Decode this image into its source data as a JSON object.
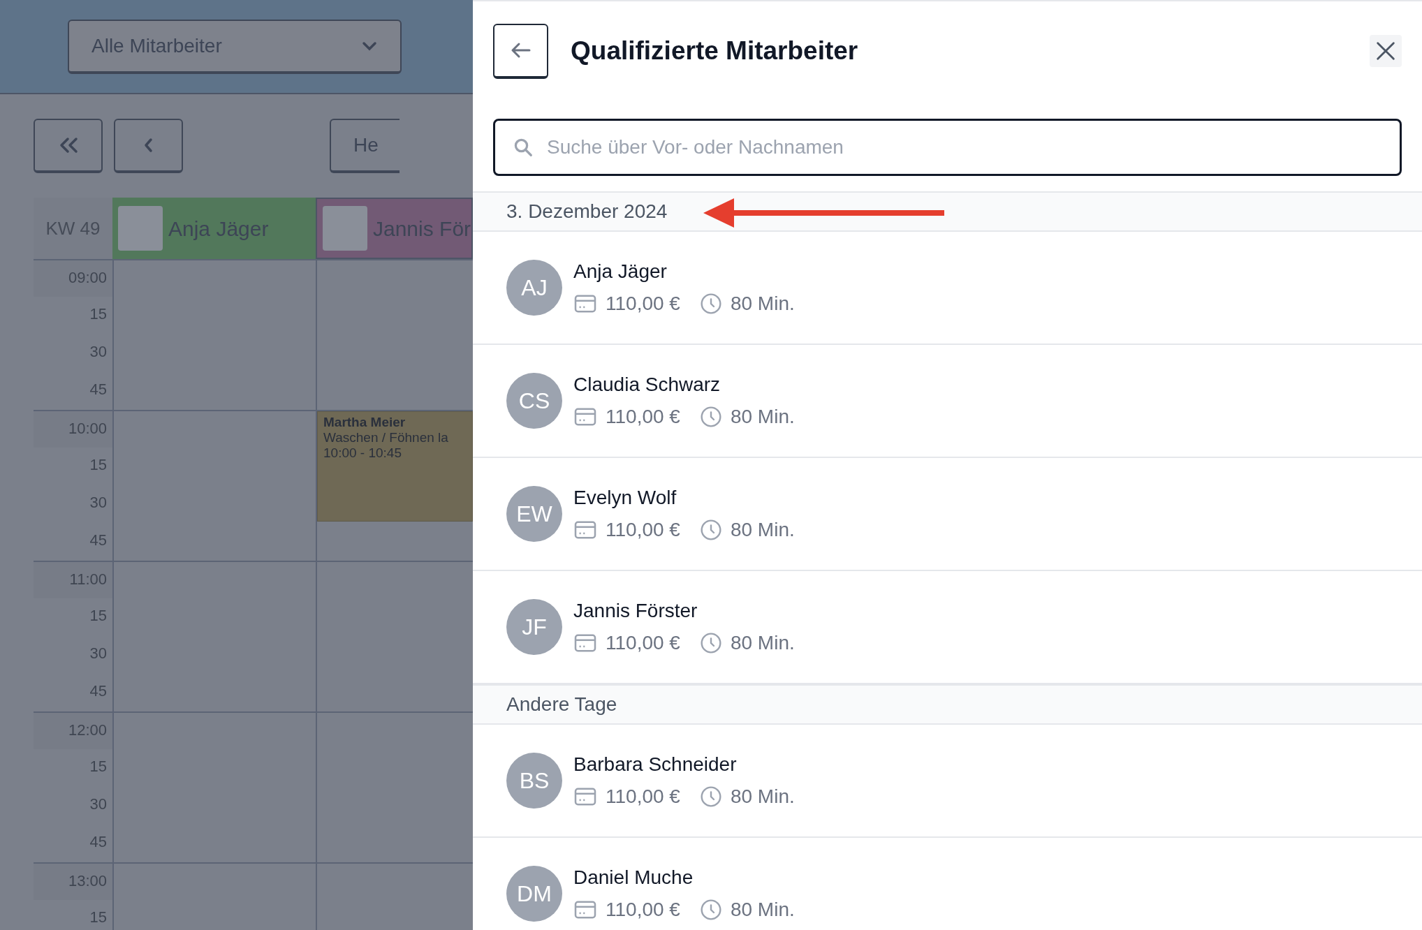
{
  "filter": {
    "value": "Alle Mitarbeiter"
  },
  "nav": {
    "today_label": "He"
  },
  "calendar": {
    "week": "KW 49",
    "columns": [
      {
        "name": "Anja Jäger",
        "color": "#52785b"
      },
      {
        "name": "Jannis För",
        "color": "#725a75",
        "events": [
          {
            "client": "Martha Meier",
            "service": "Waschen / Föhnen la",
            "time": "10:00 - 10:45",
            "color": "#6f6955"
          }
        ]
      }
    ],
    "rows": [
      {
        "time": "09:00",
        "kind": "hour"
      },
      {
        "time": "15",
        "kind": "quarter"
      },
      {
        "time": "30",
        "kind": "quarter"
      },
      {
        "time": "45",
        "kind": "quarter"
      },
      {
        "time": "10:00",
        "kind": "hour"
      },
      {
        "time": "15",
        "kind": "quarter"
      },
      {
        "time": "30",
        "kind": "quarter"
      },
      {
        "time": "45",
        "kind": "quarter"
      },
      {
        "time": "11:00",
        "kind": "hour"
      },
      {
        "time": "15",
        "kind": "quarter"
      },
      {
        "time": "30",
        "kind": "quarter"
      },
      {
        "time": "45",
        "kind": "quarter"
      },
      {
        "time": "12:00",
        "kind": "hour"
      },
      {
        "time": "15",
        "kind": "quarter"
      },
      {
        "time": "30",
        "kind": "quarter"
      },
      {
        "time": "45",
        "kind": "quarter"
      },
      {
        "time": "13:00",
        "kind": "hour"
      },
      {
        "time": "15",
        "kind": "quarter"
      }
    ]
  },
  "panel": {
    "title": "Qualifizierte Mitarbeiter",
    "search": {
      "placeholder": "Suche über Vor- oder Nachnamen"
    },
    "sections": [
      {
        "heading": "3. Dezember 2024",
        "annotated": true,
        "employees": [
          {
            "initials": "AJ",
            "name": "Anja Jäger",
            "price": "110,00 €",
            "duration": "80 Min."
          },
          {
            "initials": "CS",
            "name": "Claudia Schwarz",
            "price": "110,00 €",
            "duration": "80 Min."
          },
          {
            "initials": "EW",
            "name": "Evelyn Wolf",
            "price": "110,00 €",
            "duration": "80 Min."
          },
          {
            "initials": "JF",
            "name": "Jannis Förster",
            "price": "110,00 €",
            "duration": "80 Min."
          }
        ]
      },
      {
        "heading": "Andere Tage",
        "employees": [
          {
            "initials": "BS",
            "name": "Barbara Schneider",
            "price": "110,00 €",
            "duration": "80 Min."
          },
          {
            "initials": "DM",
            "name": "Daniel Muche",
            "price": "110,00 €",
            "duration": "80 Min."
          }
        ]
      }
    ]
  }
}
